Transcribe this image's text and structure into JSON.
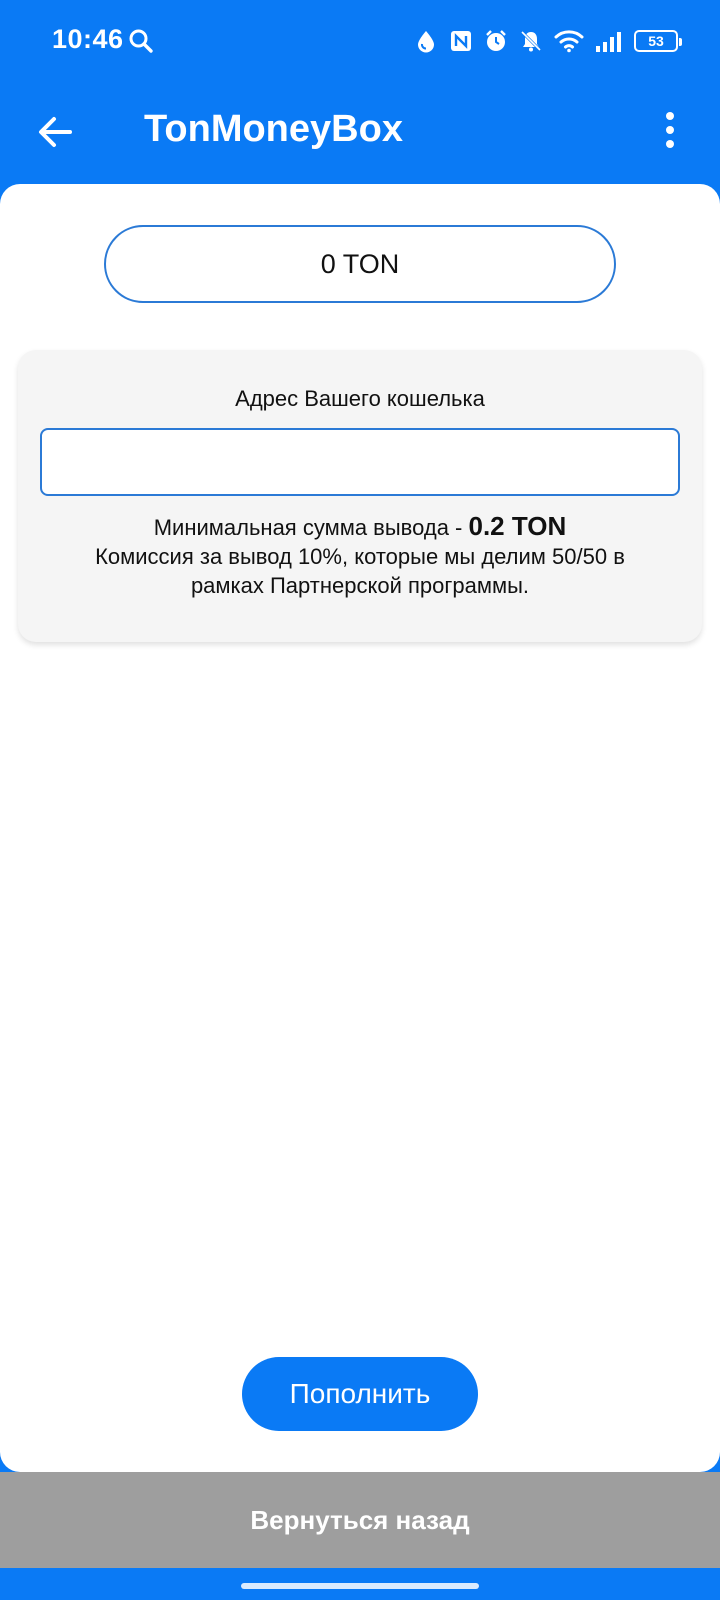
{
  "status_bar": {
    "time": "10:46",
    "battery": "53",
    "icons": [
      "search-icon",
      "water-drop-icon",
      "nfc-icon",
      "alarm-icon",
      "mute-bell-icon",
      "wifi-icon",
      "signal-icon",
      "battery-icon"
    ]
  },
  "app_bar": {
    "title": "TonMoneyBox",
    "back_icon": "back-arrow-icon",
    "menu_icon": "more-vert-icon"
  },
  "balance": {
    "text": "0 TON"
  },
  "withdraw_card": {
    "label": "Адрес Вашего кошелька",
    "input_value": "",
    "input_placeholder": "",
    "min_text": "Минимальная сумма вывода - ",
    "min_amount": "0.2 TON",
    "commission_text": "Комиссия за вывод 10%, которые мы делим 50/50 в рамках Партнерской программы."
  },
  "actions": {
    "topup_label": "Пополнить",
    "back_label": "Вернуться назад"
  },
  "colors": {
    "primary": "#0a7af5",
    "border_accent": "#2b7ad6",
    "card_bg": "#f5f5f5",
    "back_bar_bg": "#9e9e9e"
  }
}
